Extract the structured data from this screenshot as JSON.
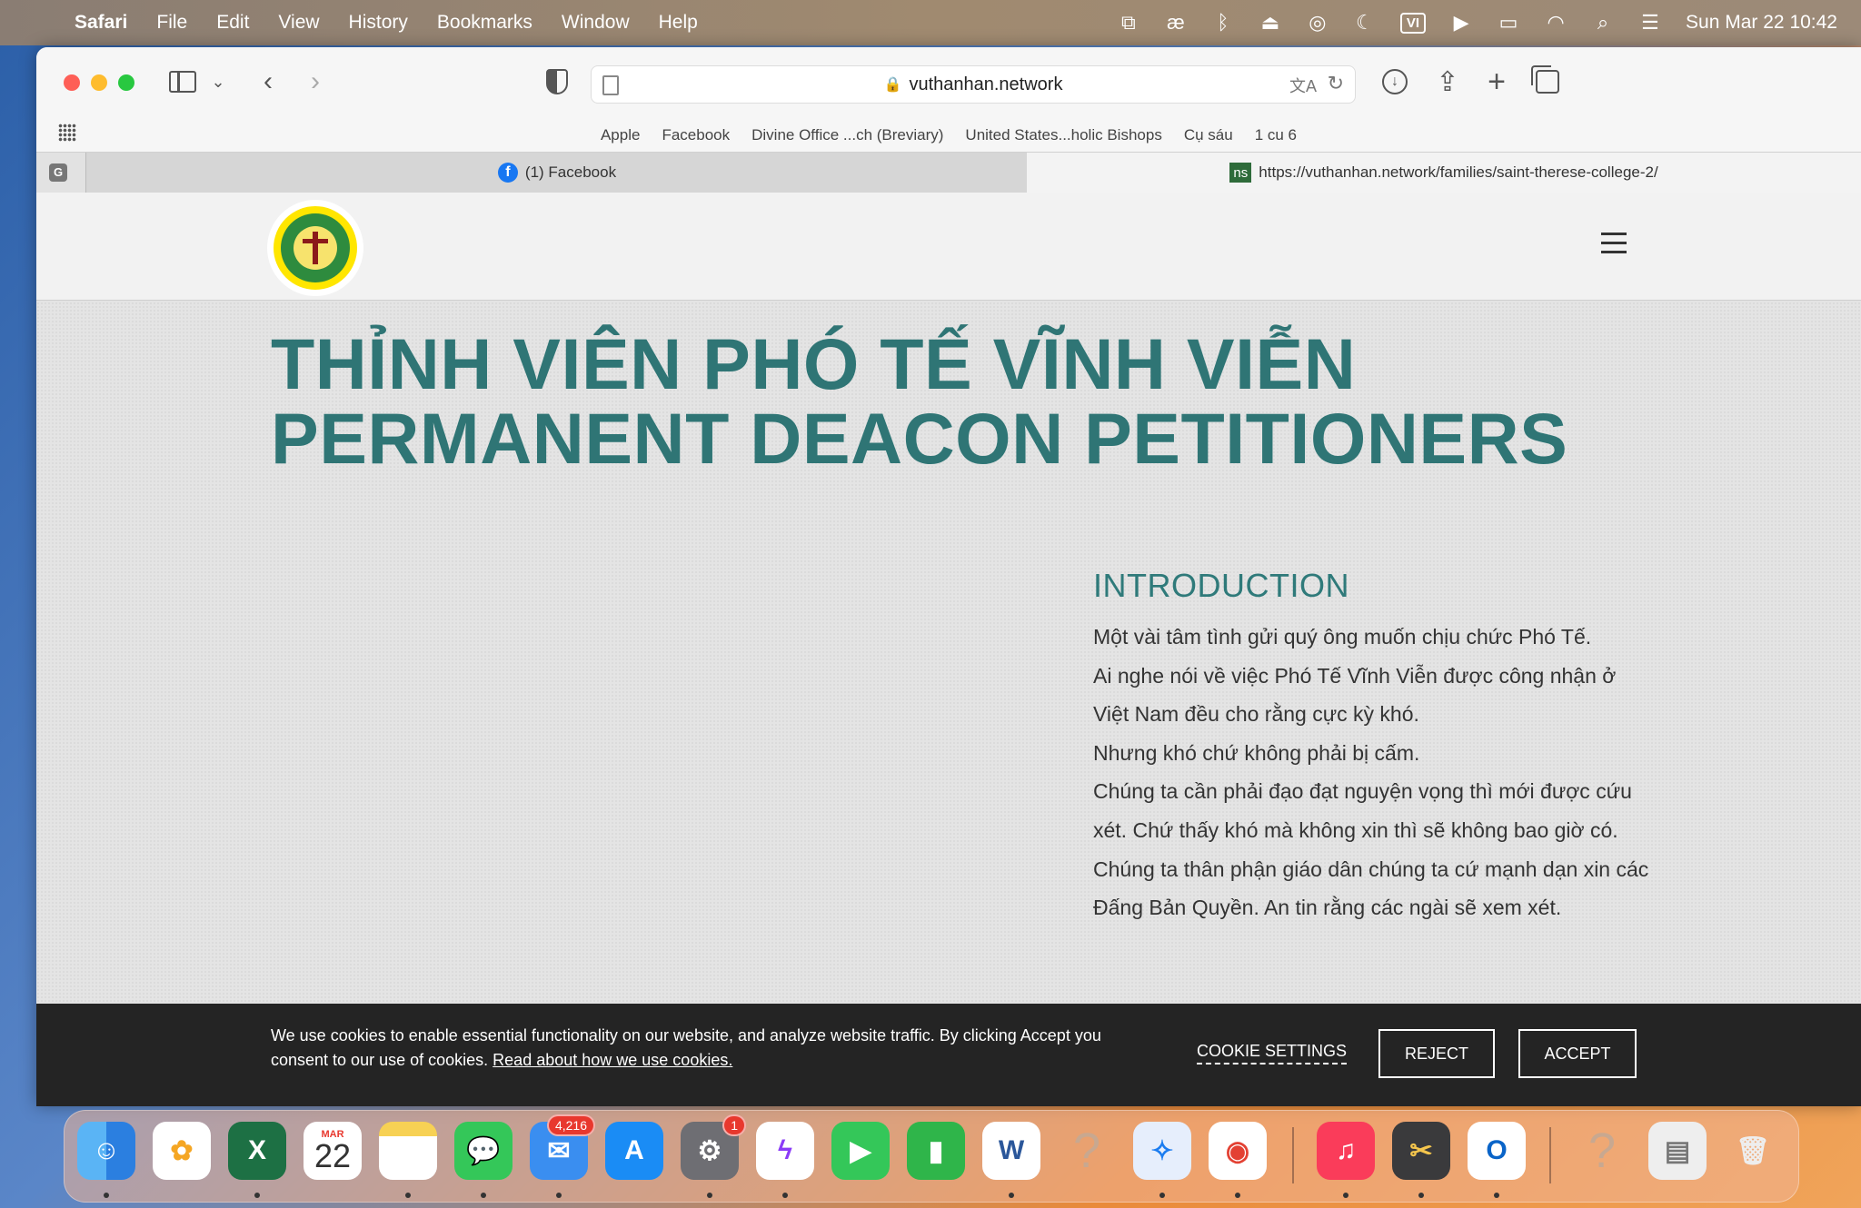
{
  "menubar": {
    "app_name": "Safari",
    "items": [
      "File",
      "Edit",
      "View",
      "History",
      "Bookmarks",
      "Window",
      "Help"
    ],
    "status_icons": [
      "translate-icon",
      "ae-icon",
      "bluetooth-icon",
      "eject-icon",
      "airdrop-icon",
      "moon-icon",
      "input-vi-icon",
      "play-icon",
      "battery-icon",
      "wifi-icon",
      "search-icon",
      "control-center-icon"
    ],
    "input_source": "VI",
    "clock": "Sun Mar 22  10:42"
  },
  "browser": {
    "url": "vuthanhan.network",
    "bookmarks": [
      "Apple",
      "Facebook",
      "Divine Office ...ch (Breviary)",
      "United States...holic Bishops",
      "Cụ sáu",
      "1 cu 6"
    ],
    "tabs": [
      {
        "label": "(1) Facebook",
        "icon": "facebook-icon"
      },
      {
        "label": "https://vuthanhan.network/families/saint-therese-college-2/",
        "icon": "ns-icon",
        "icon_text": "ns"
      }
    ],
    "group_badge": "G"
  },
  "page": {
    "title_line1": "THỈNH VIÊN PHÓ TẾ VĨNH VIỄN",
    "title_line2": "PERMANENT DEACON PETITIONERS",
    "intro_heading": "INTRODUCTION",
    "intro_paragraphs": [
      "Một vài tâm tình gửi quý ông muốn chịu chức Phó Tế.",
      "Ai nghe nói về việc Phó Tế Vĩnh Viễn được công nhận ở Việt Nam đều cho rằng cực kỳ khó.",
      "Nhưng khó chứ không phải bị cấm.",
      "Chúng ta cần phải đạo đạt nguyện vọng thì mới được cứu xét. Chứ thấy khó mà không xin thì sẽ không bao giờ có.",
      "Chúng ta thân phận giáo dân chúng ta cứ mạnh dạn xin các Đấng Bản Quyền. An tin rằng các ngài sẽ xem xét."
    ]
  },
  "cookie": {
    "text": "We use cookies to enable essential functionality on our website, and analyze website traffic. By clicking Accept you consent to our use of cookies.",
    "link": "Read about how we use cookies.",
    "settings_label": "COOKIE SETTINGS",
    "reject_label": "REJECT",
    "accept_label": "ACCEPT"
  },
  "dock": {
    "calendar_month": "MAR",
    "calendar_day": "22",
    "mail_badge": "4,216",
    "settings_badge": "1",
    "apps": [
      "finder-icon",
      "photos-icon",
      "excel-icon",
      "calendar-icon",
      "notes-icon",
      "messages-icon",
      "mail-icon",
      "app-store-icon",
      "system-settings-icon",
      "messenger-icon",
      "facetime-icon",
      "numbers-icon",
      "word-icon",
      "unknown-app-icon",
      "safari-icon",
      "chrome-icon",
      "music-icon",
      "utility-icon",
      "outlook-icon",
      "unknown-app-icon",
      "document-icon",
      "trash-icon"
    ]
  },
  "colors": {
    "title": "#2f7575",
    "accent": "#2f7a7a",
    "cookie_bg": "#161616"
  }
}
